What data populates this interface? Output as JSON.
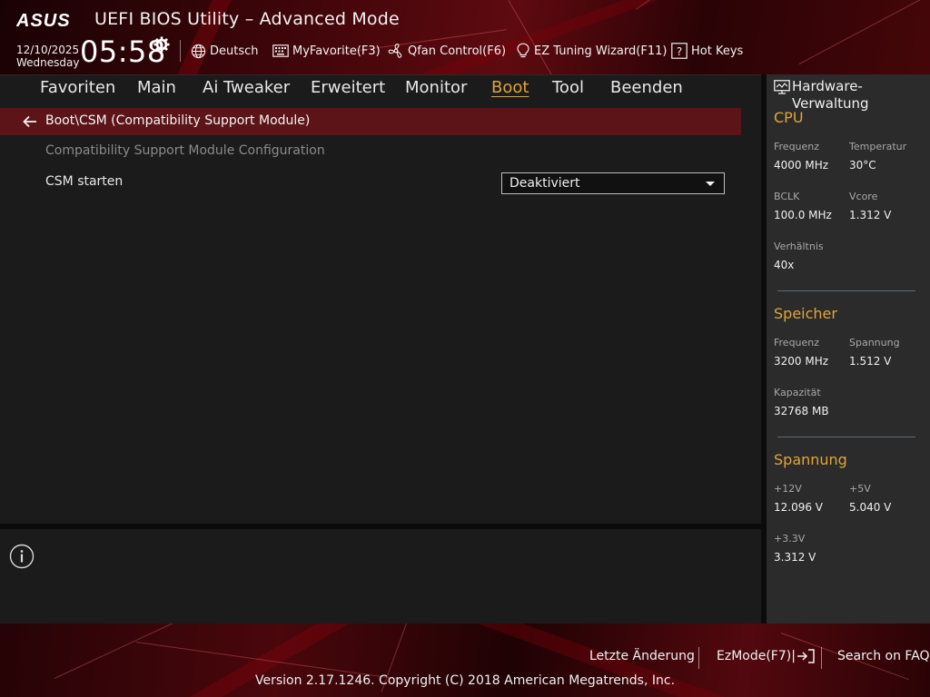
{
  "header": {
    "brand": "ASUS",
    "title": "UEFI BIOS Utility – Advanced Mode",
    "date": "12/10/2025",
    "weekday": "Wednesday",
    "time": "05:58",
    "buttons": {
      "language": "Deutsch",
      "myfavorite": "MyFavorite(F3)",
      "qfan": "Qfan Control(F6)",
      "ez_tuning": "EZ Tuning Wizard(F11)",
      "hotkeys": "Hot Keys"
    }
  },
  "nav": {
    "tabs": [
      "Favoriten",
      "Main",
      "Ai Tweaker",
      "Erweitert",
      "Monitor",
      "Boot",
      "Tool",
      "Beenden"
    ],
    "active": "Boot"
  },
  "main": {
    "breadcrumb": "Boot\\CSM (Compatibility Support Module)",
    "subtitle": "Compatibility Support Module Configuration",
    "settings": [
      {
        "label": "CSM starten",
        "value": "Deaktiviert"
      }
    ]
  },
  "hardware": {
    "title": "Hardware-Verwaltung",
    "cpu": {
      "heading": "CPU",
      "frequency_label": "Frequenz",
      "frequency": "4000 MHz",
      "temperature_label": "Temperatur",
      "temperature": "30°C",
      "bclk_label": "BCLK",
      "bclk": "100.0 MHz",
      "vcore_label": "Vcore",
      "vcore": "1.312 V",
      "ratio_label": "Verhältnis",
      "ratio": "40x"
    },
    "memory": {
      "heading": "Speicher",
      "frequency_label": "Frequenz",
      "frequency": "3200 MHz",
      "voltage_label": "Spannung",
      "voltage": "1.512 V",
      "capacity_label": "Kapazität",
      "capacity": "32768 MB"
    },
    "voltage": {
      "heading": "Spannung",
      "v12_label": "+12V",
      "v12": "12.096 V",
      "v5_label": "+5V",
      "v5": "5.040 V",
      "v33_label": "+3.3V",
      "v33": "3.312 V"
    }
  },
  "footer": {
    "last_change": "Letzte Änderung",
    "ezmode": "EzMode(F7)|",
    "faq": "Search on FAQ",
    "copyright": "Version 2.17.1246. Copyright (C) 2018 American Megatrends, Inc."
  },
  "colors": {
    "accent": "#e2a43a",
    "breadcrumb_bg": "#5c1418",
    "panel_bg": "#1b1b1b",
    "hw_bg": "#2b2b2b"
  }
}
